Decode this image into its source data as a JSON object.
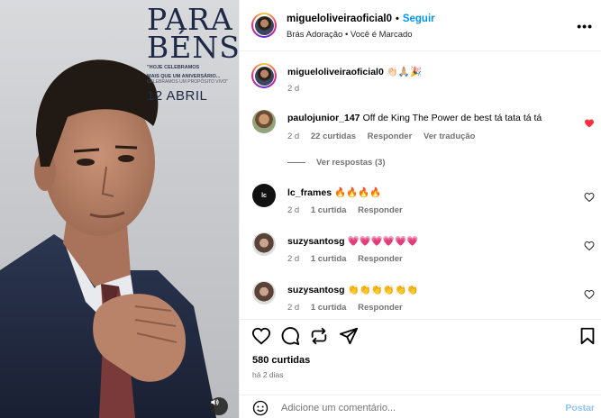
{
  "poster": {
    "title_line1": "PARA",
    "title_line2": "BÉNS",
    "sub_line1": "\"HOJE CELEBRAMOS",
    "sub_line2": "MAIS QUE UM ANIVERSÁRIO...",
    "sub_line3": "CELEBRAMOS UM PROPÓSITO VIVO\"",
    "date": "12 ABRIL"
  },
  "header": {
    "username": "migueloliveiraoficial0",
    "separator": "•",
    "follow_label": "Seguir",
    "subline": "Brás Adoração • Você é Marcado",
    "more_label": "•••"
  },
  "caption": {
    "username": "migueloliveiraoficial0",
    "text": "👏🏻🙏🏼🎉",
    "time": "2 d"
  },
  "comments": [
    {
      "username": "paulojunior_147",
      "text": "Off de King The Power de best tá tata tá tá",
      "time": "2 d",
      "likes": "22 curtidas",
      "reply": "Responder",
      "translate": "Ver tradução",
      "liked": true,
      "view_replies": "Ver respostas (3)"
    },
    {
      "username": "lc_frames",
      "text": "🔥🔥🔥🔥",
      "time": "2 d",
      "likes": "1 curtida",
      "reply": "Responder",
      "liked": false
    },
    {
      "username": "suzysantosg",
      "text": "💗💗💗💗💗💗",
      "time": "2 d",
      "likes": "1 curtida",
      "reply": "Responder",
      "liked": false
    },
    {
      "username": "suzysantosg",
      "text": "👏👏👏👏👏👏",
      "time": "2 d",
      "likes": "1 curtida",
      "reply": "Responder",
      "liked": false
    }
  ],
  "footer": {
    "likes": "580 curtidas",
    "time_ago": "há 2 dias",
    "comment_placeholder": "Adicione um comentário...",
    "post_label": "Postar"
  },
  "icons": {
    "like": "heart-outline-icon",
    "comment": "comment-bubble-icon",
    "share": "repost-icon",
    "send": "paper-plane-icon",
    "save": "bookmark-icon",
    "emoji": "smiley-icon",
    "sound": "speaker-icon"
  },
  "colors": {
    "accent": "#0095f6",
    "liked_heart": "#ff3040",
    "muted_text": "#737373",
    "post_disabled": "#8fc3f7"
  }
}
